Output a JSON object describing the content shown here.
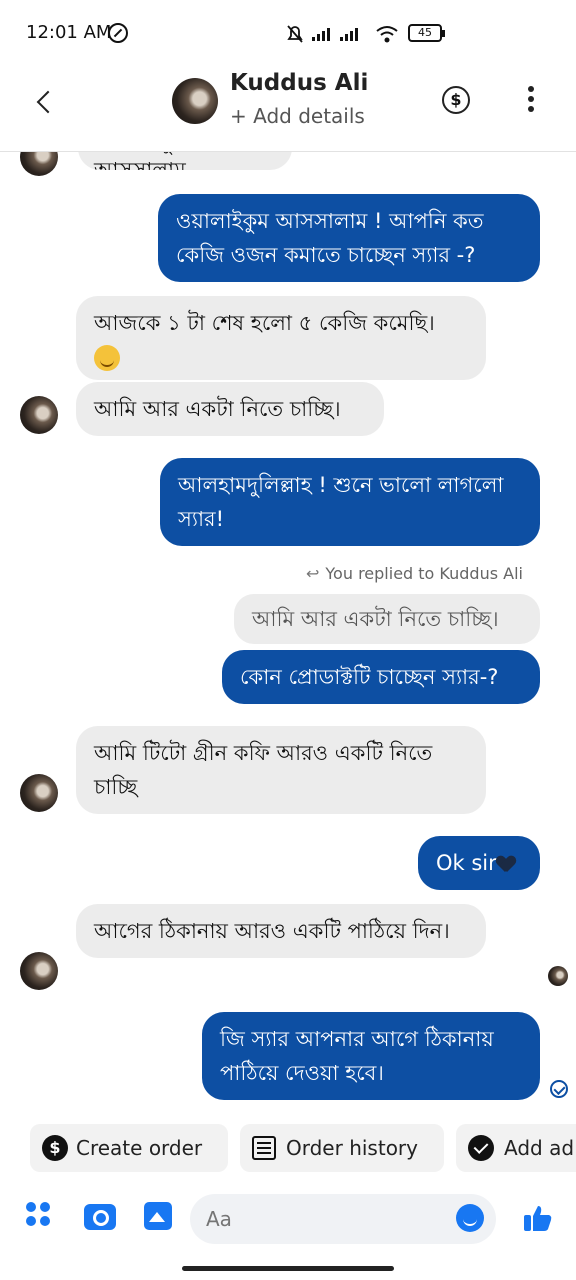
{
  "status": {
    "time": "12:01 AM",
    "battery": "45"
  },
  "header": {
    "name": "Kuddus Ali",
    "subtitle": "+ Add details",
    "dollar_glyph": "$"
  },
  "messages": [
    {
      "dir": "in",
      "text": "ওয়ালাইকুম আসসালাম"
    },
    {
      "dir": "out",
      "text": "ওয়ালাইকুম আসসালাম ! আপনি কত কেজি ওজন কমাতে চাচ্ছেন স্যার -?"
    },
    {
      "dir": "in",
      "text": "আজকে ১ টা শেষ হলো ৫ কেজি কমেছি।"
    },
    {
      "dir": "in",
      "text": "আমি আর একটা নিতে চাচ্ছি।"
    },
    {
      "dir": "out",
      "text": "আলহামদুলিল্লাহ ! শুনে ভালো লাগলো স্যার!"
    },
    {
      "dir": "quote",
      "text": "আমি আর একটা নিতে চাচ্ছি।"
    },
    {
      "dir": "out",
      "text": "কোন প্রোডাক্টটি চাচ্ছেন স্যার-?"
    },
    {
      "dir": "in",
      "text": "আমি টিটো গ্রীন কফি আরও একটি নিতে চাচ্ছি"
    },
    {
      "dir": "out",
      "text": "Ok sir"
    },
    {
      "dir": "in",
      "text": "আগের ঠিকানায় আরও একটি পাঠিয়ে দিন।"
    },
    {
      "dir": "out",
      "text": "জি স্যার আপনার আগে ঠিকানায় পাঠিয়ে দেওয়া হবে।"
    }
  ],
  "replied_label": "You replied to Kuddus Ali",
  "actions": {
    "create_order": "Create order",
    "order_history": "Order history",
    "add": "Add ad"
  },
  "composer": {
    "placeholder": "Aa"
  },
  "icons": {
    "back": "chevron-left-icon",
    "dollar": "dollar-circle-icon",
    "more": "kebab-menu-icon",
    "apps": "apps-icon",
    "camera": "camera-icon",
    "gallery": "gallery-icon",
    "emoji": "emoji-icon",
    "like": "thumbs-up-icon"
  },
  "colors": {
    "outgoing_bubble": "#0d4fa3",
    "incoming_bubble": "#ececec",
    "accent": "#1877f2"
  }
}
